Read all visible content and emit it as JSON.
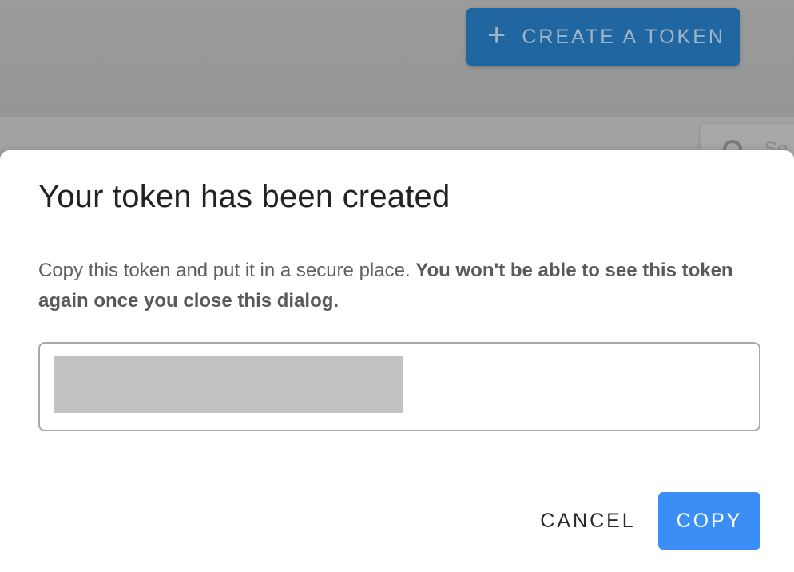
{
  "background": {
    "create_button": {
      "icon": "plus-icon",
      "label": "CREATE A TOKEN"
    },
    "search": {
      "icon": "search-icon",
      "placeholder": "Se"
    }
  },
  "dialog": {
    "title": "Your token has been created",
    "message_normal": "Copy this token and put it in a secure place. ",
    "message_bold": "You won't be able to see this token again once you close this dialog.",
    "token_value_redacted": true,
    "cancel_label": "CANCEL",
    "copy_label": "COPY"
  },
  "colors": {
    "primary": "#3b8ef5",
    "overlay_primary": "#2067a1"
  }
}
